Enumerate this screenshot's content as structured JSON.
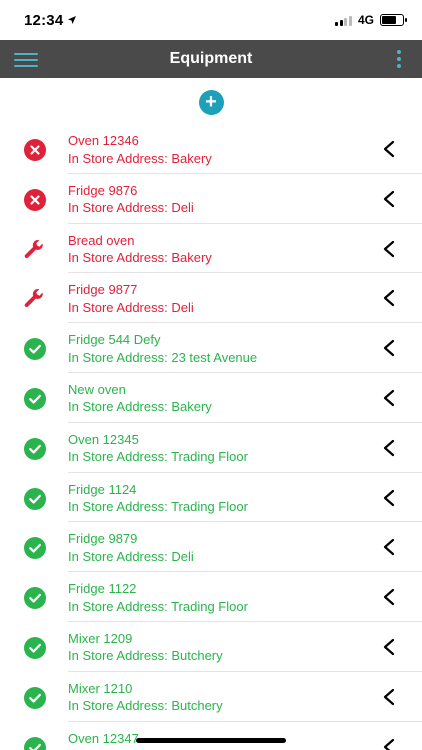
{
  "status_bar": {
    "time": "12:34",
    "network": "4G"
  },
  "nav": {
    "title": "Equipment"
  },
  "add_button": {
    "label": "+"
  },
  "colors": {
    "error": "#e0213a",
    "ok": "#2bb44d",
    "accent": "#4fb3c6",
    "nav_bg": "#4a4a4a"
  },
  "items": [
    {
      "name": "Oven 12346",
      "address": "In Store Address: Bakery",
      "status": "error",
      "icon": "x-circle-icon"
    },
    {
      "name": "Fridge 9876",
      "address": "In Store Address: Deli",
      "status": "error",
      "icon": "x-circle-icon"
    },
    {
      "name": "Bread oven",
      "address": "In Store Address: Bakery",
      "status": "repair",
      "icon": "wrench-icon"
    },
    {
      "name": "Fridge 9877",
      "address": "In Store Address: Deli",
      "status": "repair",
      "icon": "wrench-icon"
    },
    {
      "name": "Fridge 544 Defy",
      "address": "In Store Address: 23 test Avenue",
      "status": "ok",
      "icon": "check-circle-icon"
    },
    {
      "name": "New oven",
      "address": "In Store Address: Bakery",
      "status": "ok",
      "icon": "check-circle-icon"
    },
    {
      "name": "Oven 12345",
      "address": "In Store Address: Trading Floor",
      "status": "ok",
      "icon": "check-circle-icon"
    },
    {
      "name": "Fridge 1124",
      "address": "In Store Address: Trading Floor",
      "status": "ok",
      "icon": "check-circle-icon"
    },
    {
      "name": "Fridge 9879",
      "address": "In Store Address: Deli",
      "status": "ok",
      "icon": "check-circle-icon"
    },
    {
      "name": "Fridge 1122",
      "address": "In Store Address: Trading Floor",
      "status": "ok",
      "icon": "check-circle-icon"
    },
    {
      "name": "Mixer 1209",
      "address": "In Store Address: Butchery",
      "status": "ok",
      "icon": "check-circle-icon"
    },
    {
      "name": "Mixer 1210",
      "address": "In Store Address: Butchery",
      "status": "ok",
      "icon": "check-circle-icon"
    },
    {
      "name": "Oven 12347",
      "address": "",
      "status": "ok",
      "icon": "check-circle-icon"
    }
  ]
}
